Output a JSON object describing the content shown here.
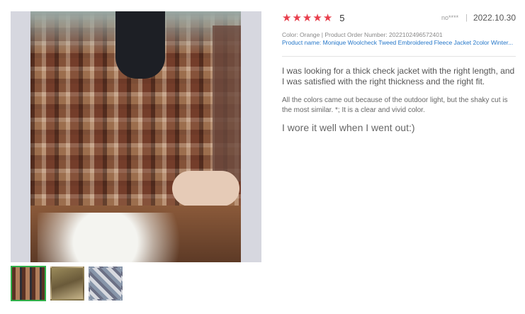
{
  "images": {
    "main_alt": "review-photo",
    "thumbnails": [
      {
        "name": "thumbnail-1"
      },
      {
        "name": "thumbnail-2"
      },
      {
        "name": "thumbnail-3"
      }
    ]
  },
  "review": {
    "rating": 5,
    "rating_label": "5",
    "stars": [
      "★",
      "★",
      "★",
      "★",
      "★"
    ],
    "star_color": "#e83e4c",
    "user": "no****",
    "separator": "|",
    "date": "2022.10.30",
    "meta": "Color: Orange | Product Order Number: 2022102496572401",
    "product_link": "Product name: Monique Woolcheck Tweed Embroidered Fleece Jacket 2color Winter...",
    "link_color": "#2577c9",
    "paragraphs": [
      "I was looking for a thick check jacket with the right length, and I was satisfied with the right thickness and the right fit.",
      "All the colors came out because of the outdoor light, but the shaky cut is the most similar. *; It is a clear and vivid color.",
      "I wore it well when I went out:)"
    ]
  },
  "accent": {
    "thumbnail_active": "#2fb04a"
  }
}
